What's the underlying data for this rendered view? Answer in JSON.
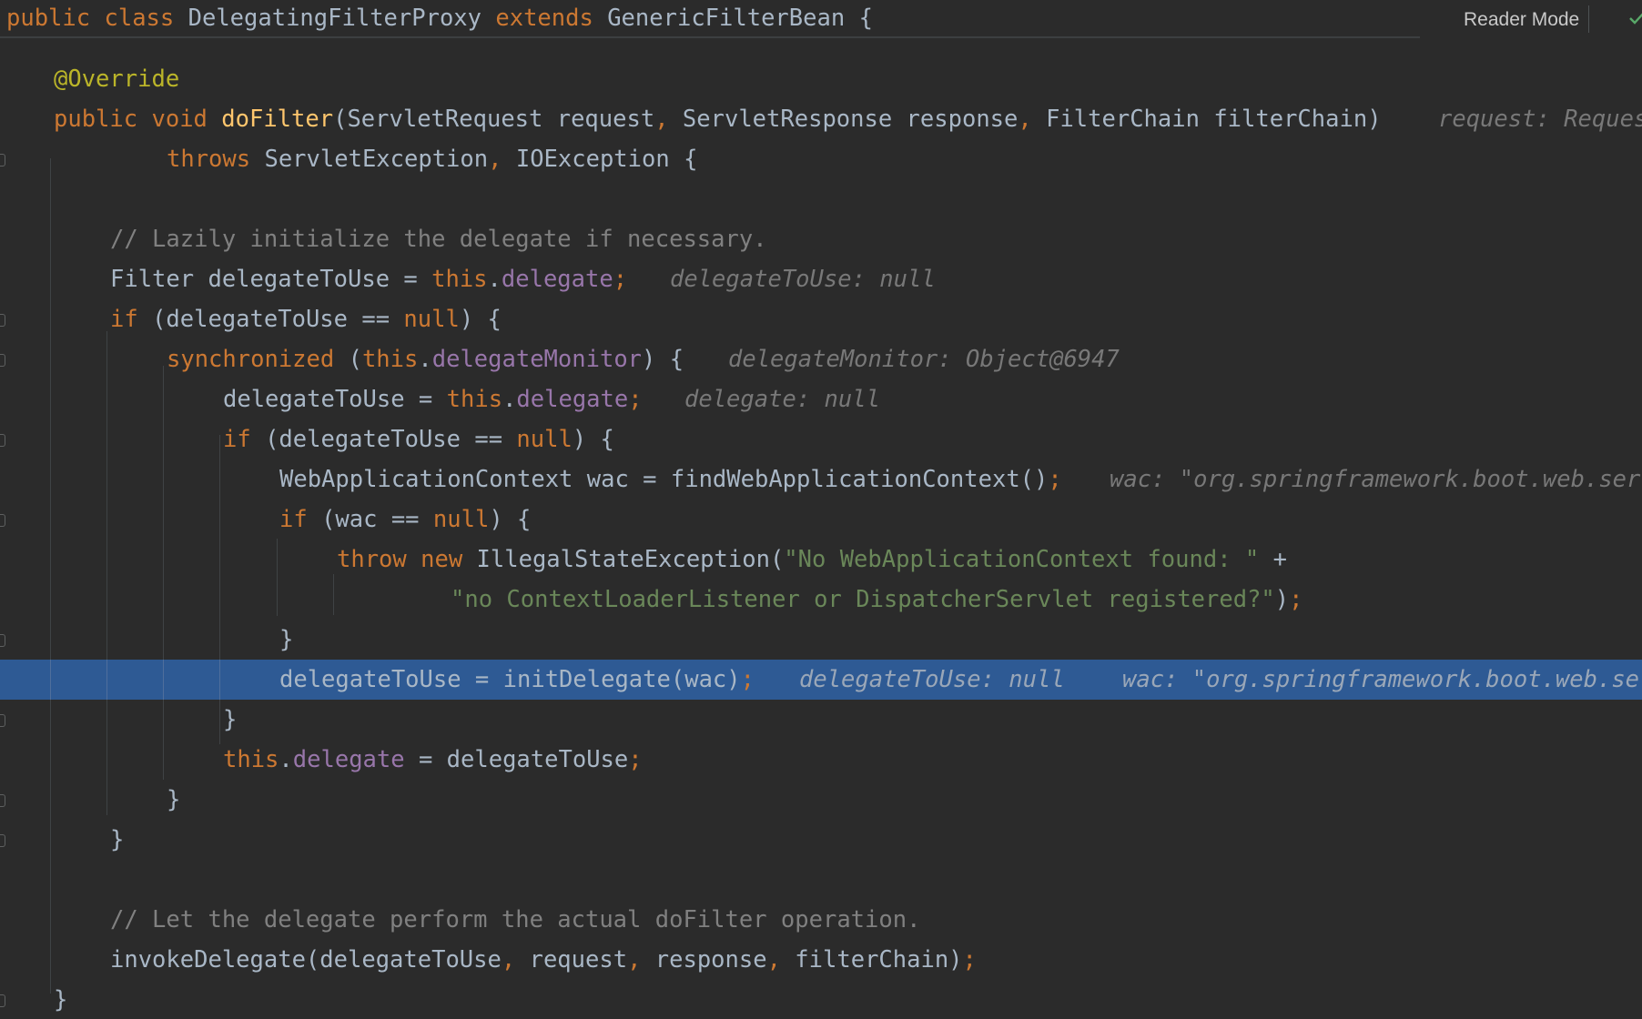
{
  "editor": {
    "reader_mode_label": "Reader Mode",
    "sticky_line": {
      "kw1": "public",
      "kw2": "class",
      "name": "DelegatingFilterProxy",
      "kw3": "extends",
      "parent": "GenericFilterBean",
      "brace": "{"
    },
    "lines": {
      "l1": {
        "annotation": "@Override"
      },
      "l2": {
        "kw1": "public",
        "kw2": "void",
        "method": "doFilter",
        "p1": "(ServletRequest request",
        "c1": ",",
        "p2": " ServletResponse response",
        "c2": ",",
        "p3": " FilterChain filterChain)",
        "hint": "request: Reques"
      },
      "l3": {
        "kw": "throws",
        "t1": " ServletException",
        "c1": ",",
        "t2": " IOException {"
      },
      "l4": {
        "comment": "// Lazily initialize the delegate if necessary."
      },
      "l5": {
        "t1": "Filter delegateToUse = ",
        "kw": "this",
        "dot": ".",
        "fld": "delegate",
        "semi": ";",
        "hint": "delegateToUse: null"
      },
      "l6": {
        "kw": "if",
        "t1": " (delegateToUse == ",
        "kw2": "null",
        "t2": ") {"
      },
      "l7": {
        "kw": "synchronized",
        "t1": " (",
        "kw2": "this",
        "dot": ".",
        "fld": "delegateMonitor",
        "t2": ") {",
        "hint": "delegateMonitor: Object@6947"
      },
      "l8": {
        "t1": "delegateToUse = ",
        "kw": "this",
        "dot": ".",
        "fld": "delegate",
        "semi": ";",
        "hint": "delegate: null"
      },
      "l9": {
        "kw": "if",
        "t1": " (delegateToUse == ",
        "kw2": "null",
        "t2": ") {"
      },
      "l10": {
        "t1": "WebApplicationContext wac = findWebApplicationContext()",
        "semi": ";",
        "hint": "wac: \"org.springframework.boot.web.ser"
      },
      "l11": {
        "kw": "if",
        "t1": " (wac == ",
        "kw2": "null",
        "t2": ") {"
      },
      "l12": {
        "kw": "throw",
        "kw2": "new",
        "t1": " IllegalStateException(",
        "str": "\"No WebApplicationContext found: \"",
        "t2": " +"
      },
      "l13": {
        "str": "\"no ContextLoaderListener or DispatcherServlet registered?\"",
        "t1": ")",
        "semi": ";"
      },
      "l14": {
        "t1": "}"
      },
      "l15": {
        "t1": "delegateToUse = initDelegate(wac)",
        "semi": ";",
        "hint1": "delegateToUse: null",
        "hint2": "wac: \"org.springframework.boot.web.se"
      },
      "l16": {
        "t1": "}"
      },
      "l17": {
        "kw": "this",
        "dot": ".",
        "fld": "delegate",
        "t1": " = delegateToUse",
        "semi": ";"
      },
      "l18": {
        "t1": "}"
      },
      "l19": {
        "t1": "}"
      },
      "l20": {
        "comment": "// Let the delegate perform the actual doFilter operation."
      },
      "l21": {
        "t1": "invokeDelegate(delegateToUse",
        "c1": ",",
        "t2": " request",
        "c2": ",",
        "t3": " response",
        "c3": ",",
        "t4": " filterChain)",
        "semi": ";"
      },
      "l22": {
        "t1": "}"
      }
    }
  }
}
